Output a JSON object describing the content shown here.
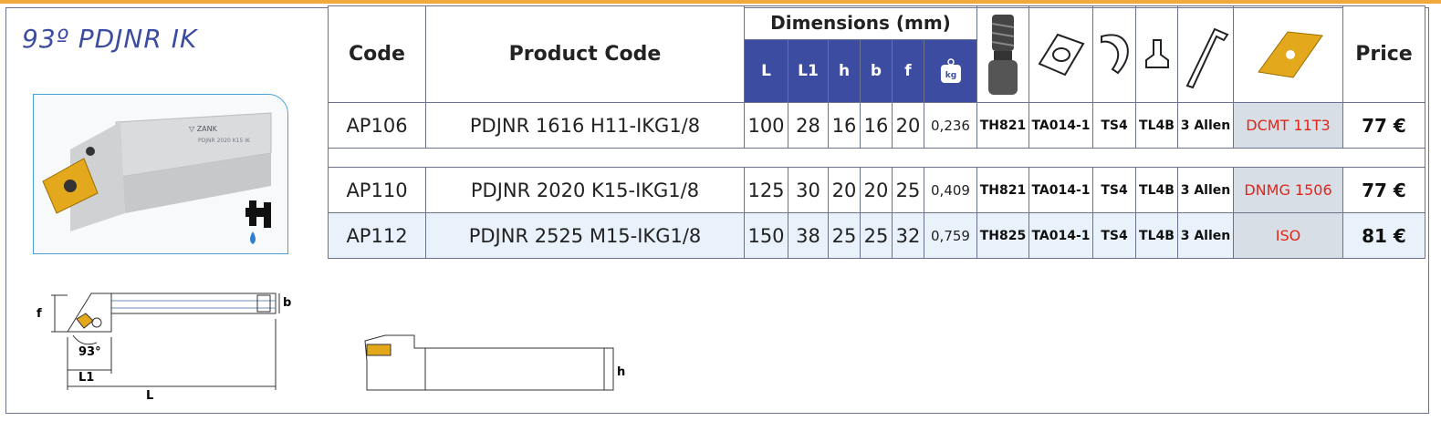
{
  "title": "93º PDJNR    IK",
  "headers": {
    "code": "Code",
    "product_code": "Product Code",
    "dimensions": "Dimensions  (mm)",
    "dim_cols": [
      "L",
      "L1",
      "h",
      "b",
      "f"
    ],
    "price": "Price"
  },
  "rows": [
    {
      "code": "AP106",
      "product_code": "PDJNR 1616 H11-IKG1/8",
      "L": "100",
      "L1": "28",
      "h": "16",
      "b": "16",
      "f": "20",
      "kg": "0,236",
      "screw": "TH821",
      "shim": "TA014-1",
      "clamp": "TS4",
      "lever": "TL4B",
      "key": "3 Allen",
      "insert": "DCMT 11T3",
      "price": "77 €"
    },
    {
      "code": "AP110",
      "product_code": "PDJNR 2020 K15-IKG1/8",
      "L": "125",
      "L1": "30",
      "h": "20",
      "b": "20",
      "f": "25",
      "kg": "0,409",
      "screw": "TH821",
      "shim": "TA014-1",
      "clamp": "TS4",
      "lever": "TL4B",
      "key": "3 Allen",
      "insert": "DNMG 1506",
      "price": "77 €"
    },
    {
      "code": "AP112",
      "product_code": "PDJNR 2525 M15-IKG1/8",
      "L": "150",
      "L1": "38",
      "h": "25",
      "b": "25",
      "f": "32",
      "kg": "0,759",
      "screw": "TH825",
      "shim": "TA014-1",
      "clamp": "TS4",
      "lever": "TL4B",
      "key": "3 Allen",
      "insert": "ISO",
      "price": "81 €"
    }
  ],
  "drawing": {
    "f": "f",
    "b": "b",
    "angle": "93°",
    "L1": "L1",
    "L": "L",
    "h": "h"
  },
  "colors": {
    "header_blue": "#3c4ca0",
    "insert_red": "#e0261b",
    "row_alt": "#e9f2fb",
    "insert_gold": "#e4a81c"
  }
}
